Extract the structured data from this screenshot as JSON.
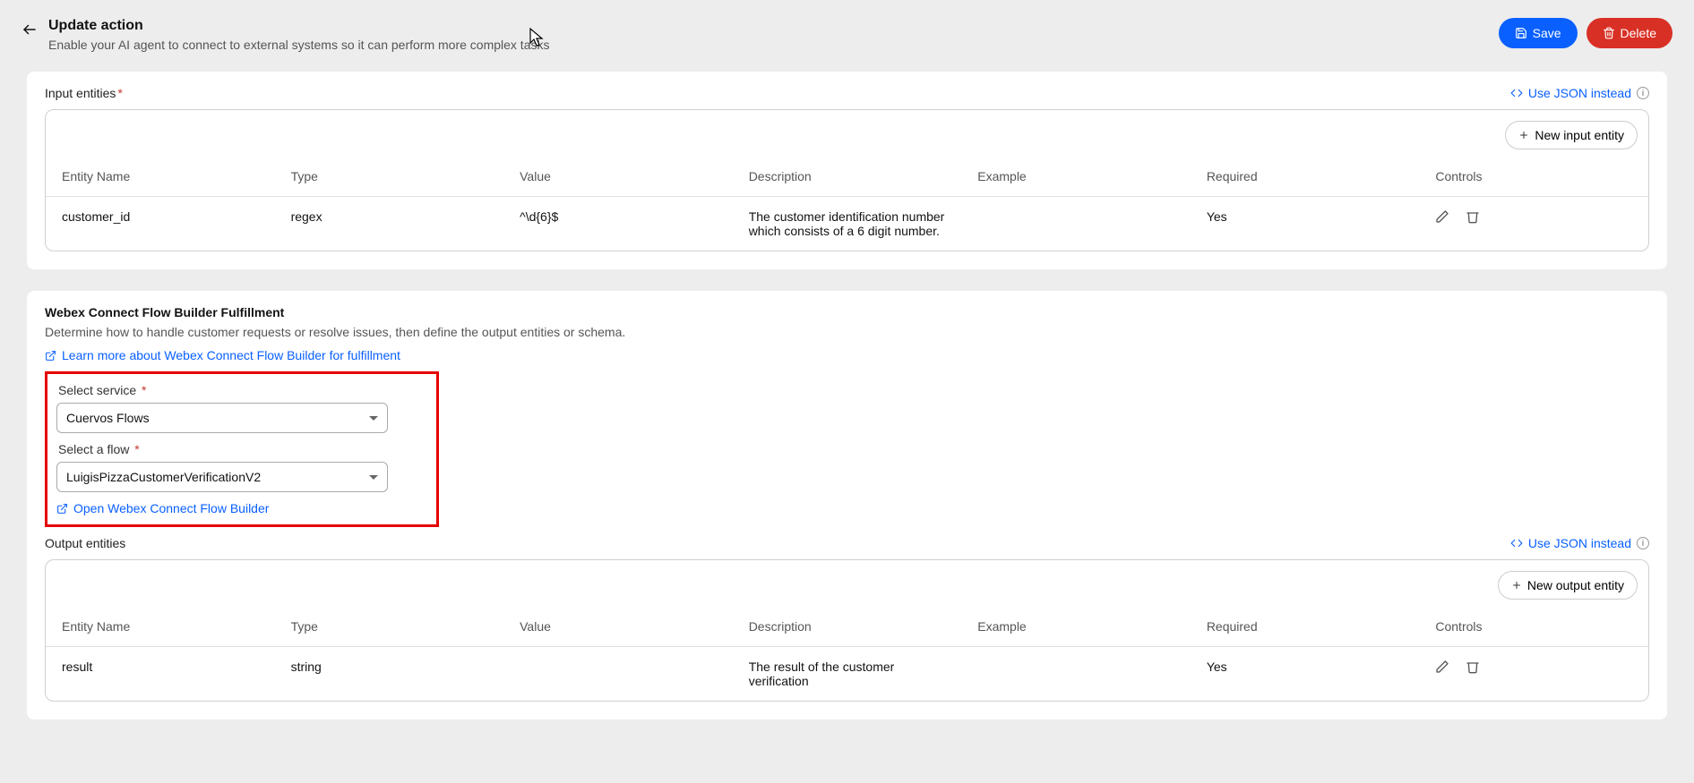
{
  "header": {
    "title": "Update action",
    "subtitle": "Enable your AI agent to connect to external systems so it can perform more complex tasks",
    "save": "Save",
    "delete": "Delete"
  },
  "inputEntities": {
    "label": "Input entities",
    "json_link": "Use JSON instead",
    "new_btn": "New input entity",
    "columns": {
      "name": "Entity Name",
      "type": "Type",
      "value": "Value",
      "description": "Description",
      "example": "Example",
      "required": "Required",
      "controls": "Controls"
    },
    "rows": [
      {
        "name": "customer_id",
        "type": "regex",
        "value": "^\\d{6}$",
        "description": "The customer identification number which consists of a 6 digit number.",
        "example": "",
        "required": "Yes"
      }
    ]
  },
  "fulfillment": {
    "title": "Webex Connect Flow Builder Fulfillment",
    "desc": "Determine how to handle customer requests or resolve issues, then define the output entities or schema.",
    "learn_link": "Learn more about Webex Connect Flow Builder for fulfillment",
    "service_label": "Select service",
    "service_value": "Cuervos Flows",
    "flow_label": "Select a flow",
    "flow_value": "LuigisPizzaCustomerVerificationV2",
    "open_link": "Open Webex Connect Flow Builder"
  },
  "outputEntities": {
    "label": "Output entities",
    "json_link": "Use JSON instead",
    "new_btn": "New output entity",
    "columns": {
      "name": "Entity Name",
      "type": "Type",
      "value": "Value",
      "description": "Description",
      "example": "Example",
      "required": "Required",
      "controls": "Controls"
    },
    "rows": [
      {
        "name": "result",
        "type": "string",
        "value": "",
        "description": "The result of the customer verification",
        "example": "",
        "required": "Yes"
      }
    ]
  }
}
